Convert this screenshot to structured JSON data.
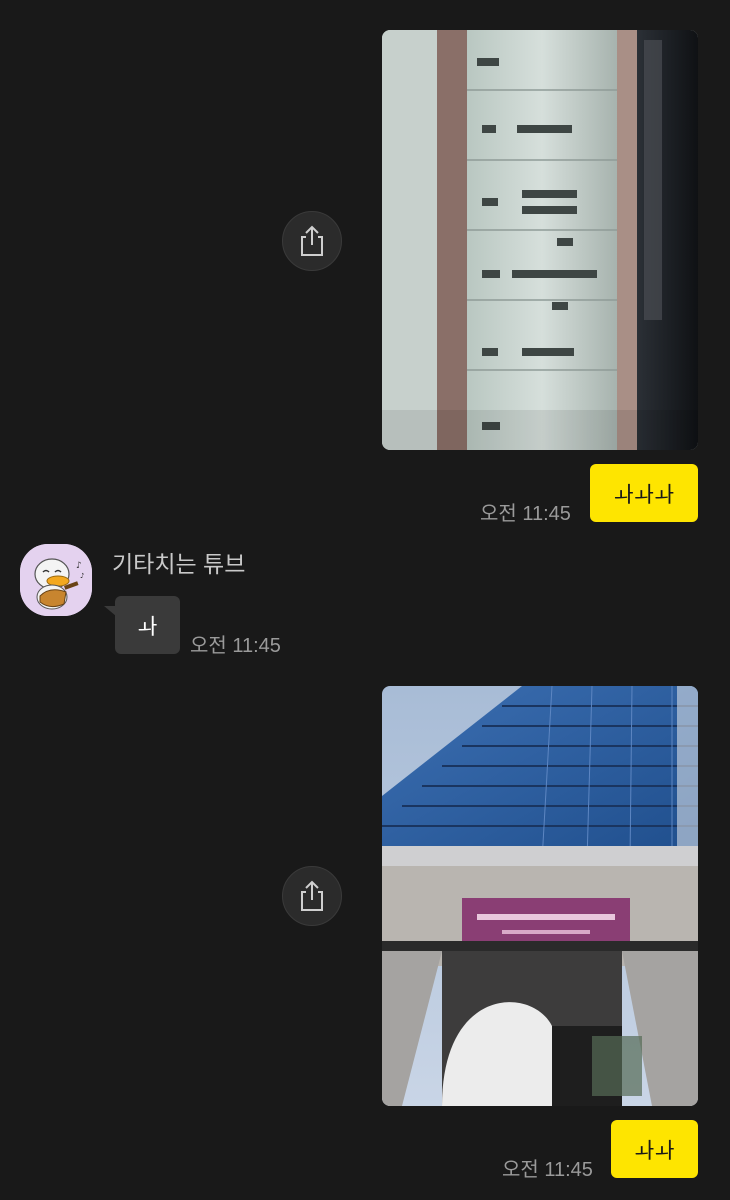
{
  "messages": {
    "outgoing_1": {
      "text": "ㅘㅘㅘ",
      "time": "오전 11:45"
    },
    "incoming_1": {
      "sender": "기타치는 튜브",
      "text": "ㅘ",
      "time": "오전 11:45"
    },
    "outgoing_2": {
      "text": "ㅘㅘ",
      "time": "오전 11:45"
    }
  },
  "icons": {
    "share": "share-icon",
    "avatar": "tube-character-guitar-avatar"
  },
  "colors": {
    "background": "#191919",
    "my_bubble": "#fee500",
    "other_bubble": "#3a3a3a",
    "time_text": "#9a9a9a"
  }
}
